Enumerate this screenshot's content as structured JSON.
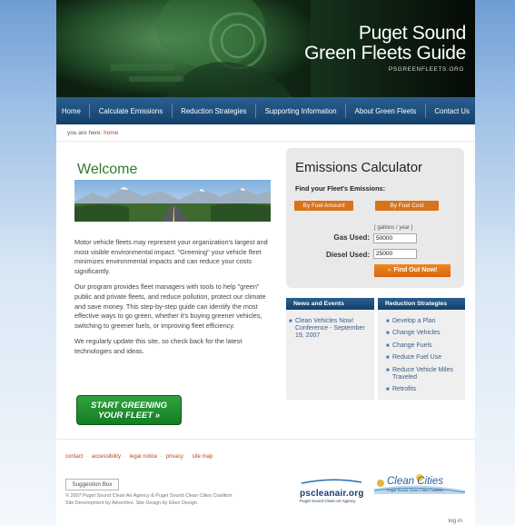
{
  "header": {
    "title_line1": "Puget Sound",
    "title_line2": "Green Fleets Guide",
    "url_text": "PSGREENFLEETS.ORG"
  },
  "nav": {
    "items": [
      "Home",
      "Calculate Emissions",
      "Reduction Strategies",
      "Supporting Information",
      "About Green Fleets",
      "Contact Us"
    ]
  },
  "breadcrumb": {
    "prefix": "you are here:",
    "current": "home"
  },
  "main": {
    "heading": "Welcome",
    "paragraphs": [
      "Motor vehicle fleets may represent your organization's largest and most visible environmental impact. \"Greening\" your vehicle fleet minimizes environmental impacts and can reduce your costs significantly.",
      "Our program provides fleet managers with tools to help \"green\" public and private fleets, and reduce pollution, protect our climate and save money. This step-by-step guide can identify the most effective ways to go green, whether it's buying greener vehicles, switching to greener fuels, or improving fleet efficiency.",
      "We regularly update this site, so check back for the latest technologies and ideas."
    ],
    "cta_line1": "START GREENING",
    "cta_line2": "YOUR FLEET »"
  },
  "calculator": {
    "title": "Emissions Calculator",
    "subtitle": "Find your Fleet's Emissions:",
    "by_fuel_amount": "By Fuel Amount",
    "by_fuel_cost": "By Fuel Cost",
    "units": "[ gallons / year ]",
    "gas_label": "Gas Used:",
    "gas_value": "50000",
    "diesel_label": "Diesel Used:",
    "diesel_value": "25000",
    "submit_label": "Find Out Now!"
  },
  "news": {
    "header": "News and Events",
    "items": [
      "Clean Vehicles Now! Conference - September 19, 2007"
    ]
  },
  "reduction": {
    "header": "Reduction Strategies",
    "items": [
      "Develop a Plan",
      "Change Vehicles",
      "Change Fuels",
      "Reduce Fuel Use",
      "Reduce Vehicle Miles Traveled",
      "Retrofits"
    ]
  },
  "footer": {
    "links": [
      "contact",
      "accessibility",
      "legal notice",
      "privacy",
      "site map"
    ],
    "suggestion_box": "Suggestion Box",
    "copyright_line1": "© 2007 Puget Sound Clean Air Agency & Puget Sound Clean Cities Coalition",
    "copyright_line2": "Site Development by Adventive. Site Design by Eben Design.",
    "login": "log in",
    "logo1_text": "pscleanair.org",
    "logo1_sub": "Puget Sound Clean Air Agency",
    "logo2_text": "Clean Cities",
    "logo2_sub": "Puget Sound Clean Cities Coalition"
  },
  "colors": {
    "nav_blue": "#14406b",
    "accent_orange": "#d8731c",
    "heading_green": "#2f7a2f",
    "link_red": "#c0431a"
  }
}
